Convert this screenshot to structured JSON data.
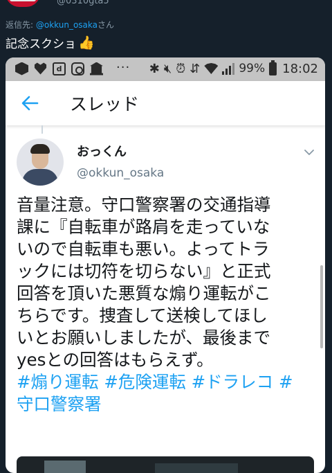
{
  "outer_tweet": {
    "handle": "@0310gta5",
    "reply_prefix": "返信先: ",
    "reply_mention": "@okkun_osaka",
    "reply_suffix": "さん",
    "text": "記念スクショ",
    "emoji": "👍"
  },
  "status_bar": {
    "notification_icons": [
      "cube-app-icon",
      "heart-icon",
      "d-app-icon",
      "instagram-icon",
      "bank-app-icon"
    ],
    "more": "···",
    "bluetooth": "✱",
    "mute": "🔇︎",
    "alarm": "⏰︎",
    "data_arrows": "⇵",
    "battery_percent": "99%",
    "time": "18:02"
  },
  "app_bar": {
    "title": "スレッド"
  },
  "tweet": {
    "author_name": "おっくん",
    "author_handle": "@okkun_osaka",
    "body_lines": [
      "音量注意。守口警察署の交通指導",
      "課に『自転車が路肩を走っていな",
      "いので自転車も悪い。よってトラ",
      "ックには切符を切らない』と正式",
      "回答を頂いた悪質な煽り運転がこ",
      "ちらです。捜査して送検してほし",
      "いとお願いしましたが、最後まで",
      "yesとの回答はもらえず。"
    ],
    "hashtags": [
      "#煽り運転",
      "#危険運転",
      "#ドラレコ",
      "#",
      "守口警察署"
    ]
  },
  "colors": {
    "background": "#15202b",
    "link": "#1da1f2",
    "status_bar": "#c4c4c4"
  }
}
